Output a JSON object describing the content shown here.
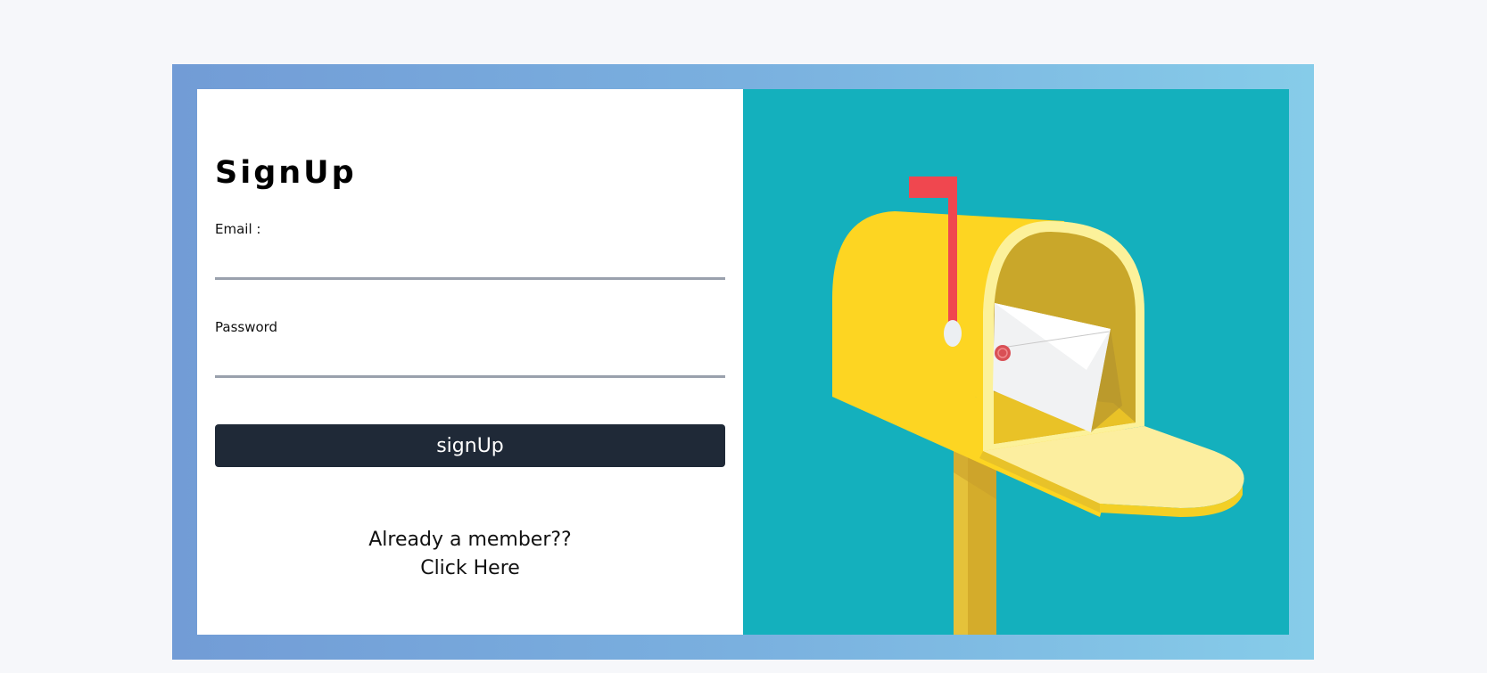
{
  "signup": {
    "title": "SignUp",
    "email_label": "Email :",
    "email_value": "",
    "password_label": "Password",
    "password_value": "",
    "submit_label": "signUp",
    "member_prompt": "Already a member??",
    "member_link": "Click Here"
  },
  "illustration": {
    "icon": "mailbox-icon",
    "background_color": "#14b0bd"
  },
  "colors": {
    "frame_gradient_start": "#729cd6",
    "frame_gradient_end": "#86cce9",
    "button": "#1f2937",
    "field_underline": "#9aa1ad"
  }
}
